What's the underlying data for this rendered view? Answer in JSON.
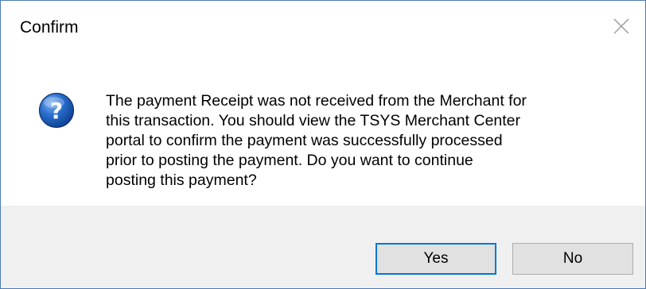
{
  "dialog": {
    "title": "Confirm",
    "icon": "question-icon",
    "message": "The payment Receipt was not received from the Merchant for\nthis transaction. You should view the TSYS Merchant Center\nportal to confirm the payment was successfully processed\nprior to posting the payment. Do you want to continue\nposting this payment?",
    "buttons": {
      "yes_label": "Yes",
      "no_label": "No"
    }
  },
  "colors": {
    "border": "#4a7ab5",
    "footer_background": "#f0f0f0",
    "button_background": "#e1e1e1",
    "default_button_border": "#0078d7",
    "icon_blue": "#1f5fb4"
  }
}
